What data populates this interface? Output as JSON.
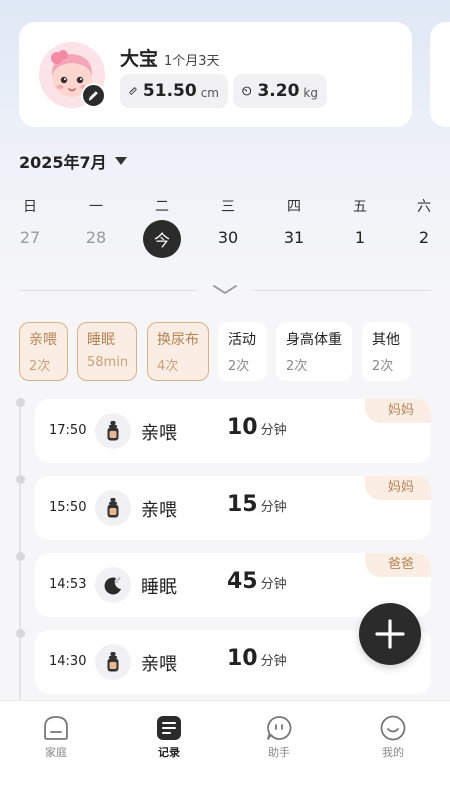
{
  "profile": {
    "name": "大宝",
    "age": "1个月3天",
    "height_value": "51.50",
    "height_unit": "cm",
    "weight_value": "3.20",
    "weight_unit": "kg"
  },
  "calendar": {
    "month_label": "2025年7月",
    "weekdays": [
      "日",
      "一",
      "二",
      "三",
      "四",
      "五",
      "六"
    ],
    "dates": [
      "27",
      "28",
      "今",
      "30",
      "31",
      "1",
      "2"
    ]
  },
  "categories": [
    {
      "title": "亲喂",
      "sub": "2次"
    },
    {
      "title": "睡眠",
      "sub": "58min"
    },
    {
      "title": "换尿布",
      "sub": "4次"
    },
    {
      "title": "活动",
      "sub": "2次"
    },
    {
      "title": "身高体重",
      "sub": "2次"
    },
    {
      "title": "其他",
      "sub": "2次"
    }
  ],
  "records": [
    {
      "time": "17:50",
      "type": "亲喂",
      "value": "10",
      "unit": "分钟",
      "who": "妈妈",
      "icon": "bottle-icon"
    },
    {
      "time": "15:50",
      "type": "亲喂",
      "value": "15",
      "unit": "分钟",
      "who": "妈妈",
      "icon": "bottle-icon"
    },
    {
      "time": "14:53",
      "type": "睡眠",
      "value": "45",
      "unit": "分钟",
      "who": "爸爸",
      "icon": "moon-icon"
    },
    {
      "time": "14:30",
      "type": "亲喂",
      "value": "10",
      "unit": "分钟",
      "who": "",
      "icon": "bottle-icon"
    }
  ],
  "tabs": [
    {
      "label": "家庭"
    },
    {
      "label": "记录"
    },
    {
      "label": "助手"
    },
    {
      "label": "我的"
    }
  ],
  "colors": {
    "accent": "#b58456",
    "accent_bg": "#faeee4",
    "dark": "#2b2b2b"
  }
}
